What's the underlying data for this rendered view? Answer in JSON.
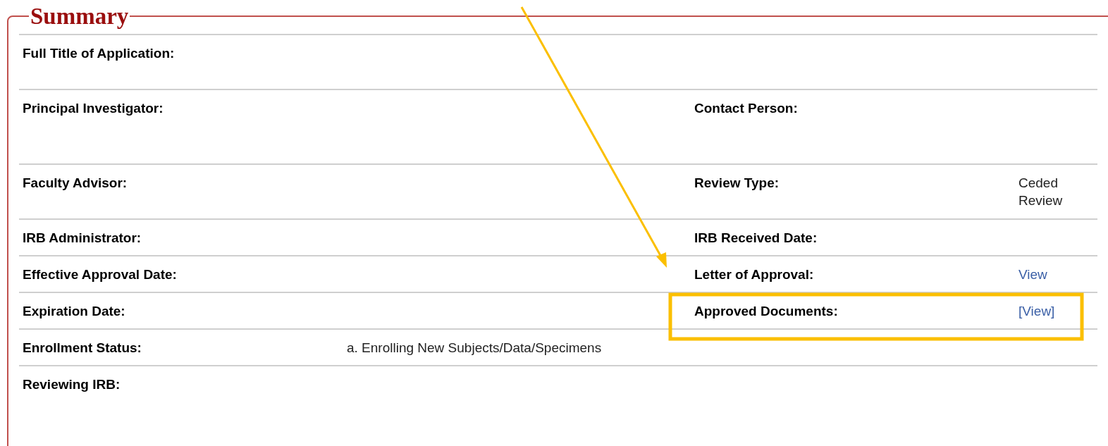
{
  "section": {
    "title": "Summary"
  },
  "rows": [
    {
      "cells": [
        {
          "label": "Full Title of Application:"
        }
      ]
    },
    {
      "cells": [
        {
          "label": "Principal Investigator:"
        },
        {
          "label": "Contact Person:"
        }
      ]
    },
    {
      "cells": [
        {
          "label": "Faculty Advisor:"
        },
        {
          "label": "Review Type:",
          "value": "Ceded Review"
        }
      ]
    },
    {
      "cells": [
        {
          "label": "IRB Administrator:"
        },
        {
          "label": "IRB Received Date:"
        }
      ]
    },
    {
      "cells": [
        {
          "label": "Effective Approval Date:"
        },
        {
          "label": "Letter of Approval:",
          "value": "View",
          "kind": "link"
        }
      ]
    },
    {
      "cells": [
        {
          "label": "Expiration Date:"
        },
        {
          "label": "Approved Documents:",
          "value": "[View]",
          "kind": "link"
        }
      ]
    },
    {
      "cells": [
        {
          "label": "Enrollment Status:",
          "value": "a. Enrolling New Subjects/Data/Specimens"
        }
      ]
    },
    {
      "cells": [
        {
          "label": "Reviewing IRB:"
        }
      ]
    }
  ]
}
